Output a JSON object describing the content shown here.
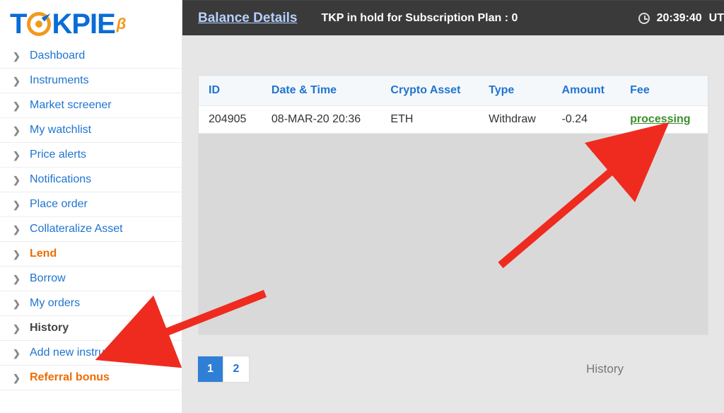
{
  "logo": {
    "text_left": "T",
    "text_right": "KPIE",
    "beta": "β"
  },
  "sidebar": {
    "items": [
      {
        "label": "Dashboard",
        "style": "blue"
      },
      {
        "label": "Instruments",
        "style": "blue"
      },
      {
        "label": "Market screener",
        "style": "blue"
      },
      {
        "label": "My watchlist",
        "style": "blue"
      },
      {
        "label": "Price alerts",
        "style": "blue"
      },
      {
        "label": "Notifications",
        "style": "blue"
      },
      {
        "label": "Place order",
        "style": "blue"
      },
      {
        "label": "Collateralize Asset",
        "style": "blue"
      },
      {
        "label": "Lend",
        "style": "orange"
      },
      {
        "label": "Borrow",
        "style": "blue"
      },
      {
        "label": "My orders",
        "style": "blue"
      },
      {
        "label": "History",
        "style": "active"
      },
      {
        "label": "Add new instrument",
        "style": "blue"
      },
      {
        "label": "Referral bonus",
        "style": "orange"
      }
    ]
  },
  "topbar": {
    "balance_link": "Balance Details",
    "tkp_hold": "TKP in hold for Subscription Plan : 0",
    "time": "20:39:40",
    "tz": "UT"
  },
  "table": {
    "headers": [
      "ID",
      "Date & Time",
      "Crypto Asset",
      "Type",
      "Amount",
      "Fee"
    ],
    "rows": [
      {
        "id": "204905",
        "datetime": "08-MAR-20 20:36",
        "asset": "ETH",
        "type": "Withdraw",
        "amount": "-0.24",
        "fee": "processing"
      }
    ]
  },
  "pager": {
    "pages": [
      "1",
      "2"
    ],
    "active": 0,
    "label": "History"
  }
}
